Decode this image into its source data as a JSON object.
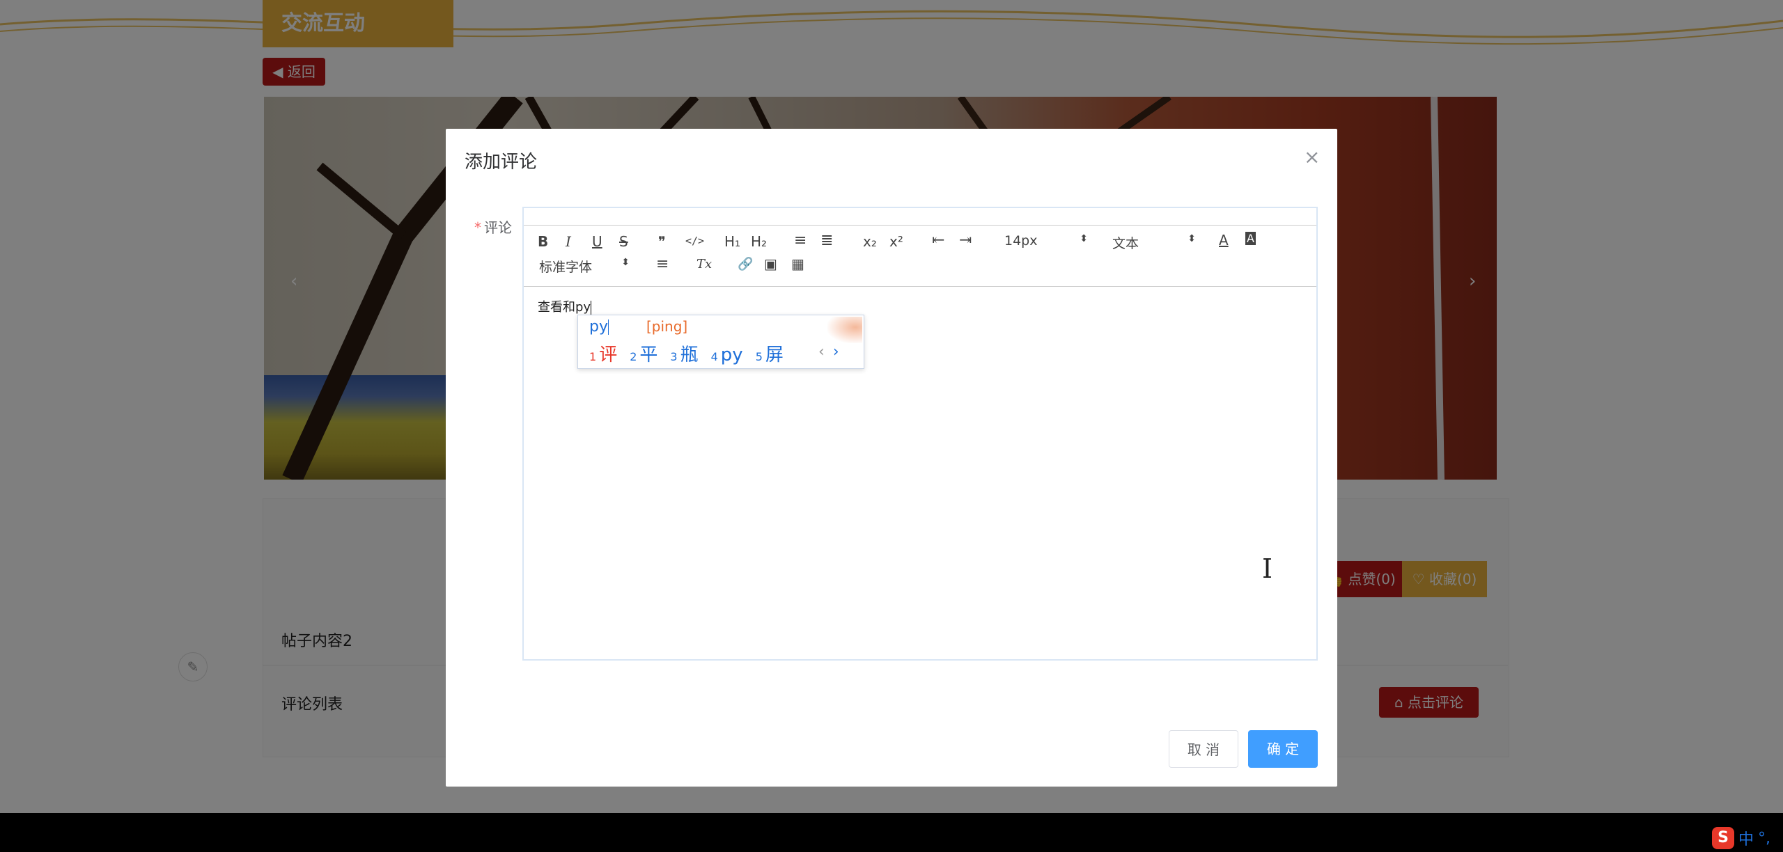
{
  "page": {
    "section_tab": "交流互动",
    "back_label": "返回",
    "like_label": "点赞(0)",
    "favorite_label": "收藏(0)",
    "post_content": "帖子内容2",
    "comment_list_title": "评论列表",
    "comment_button_label": "点击评论",
    "carousel_prev": "‹",
    "carousel_next": "›"
  },
  "dialog": {
    "title": "添加评论",
    "close_icon": "×",
    "field_label": "评论",
    "required_mark": "*",
    "cancel_label": "取 消",
    "ok_label": "确 定"
  },
  "toolbar": {
    "bold": "B",
    "italic": "I",
    "underline": "U",
    "strike": "S",
    "blockquote": "❞",
    "code": "</>",
    "h1": "H₁",
    "h2": "H₂",
    "ordered_list": "≡",
    "bullet_list": "≣",
    "subscript": "x₂",
    "superscript": "x²",
    "outdent": "⇤",
    "indent": "⇥",
    "font_size": "14px",
    "header_select": "文本",
    "font_color": "A",
    "background_color": "A",
    "font_family": "标准字体",
    "align": "≡",
    "clean": "Tx",
    "link": "🔗",
    "image": "▣",
    "video": "▦"
  },
  "editor": {
    "content": "查看和py"
  },
  "ime": {
    "input": "py",
    "pinyin": "[ping]",
    "candidates": [
      {
        "num": "1",
        "text": "评"
      },
      {
        "num": "2",
        "text": "平"
      },
      {
        "num": "3",
        "text": "瓶"
      },
      {
        "num": "4",
        "text": "py"
      },
      {
        "num": "5",
        "text": "屏"
      }
    ],
    "prev": "‹",
    "next": "›"
  },
  "taskbar": {
    "ime_logo": "S",
    "ime_mode": "中",
    "ime_punct": "°,"
  },
  "colors": {
    "brand_red": "#b81818",
    "brand_gold": "#e8b03c",
    "primary_blue": "#409eff"
  }
}
